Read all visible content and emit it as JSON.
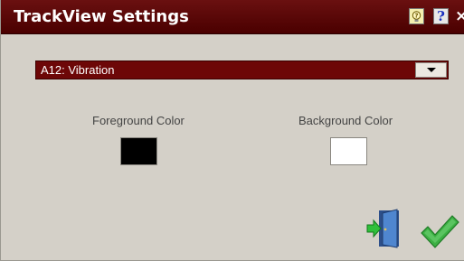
{
  "window": {
    "title": "TrackView Settings",
    "hint_icon": "hint-bulb-icon",
    "help_label": "?",
    "close_label": "×"
  },
  "track_select": {
    "selected": "A12: Vibration"
  },
  "foreground": {
    "label": "Foreground Color",
    "color": "#000000"
  },
  "background": {
    "label": "Background Color",
    "color": "#ffffff"
  },
  "actions": {
    "exit_icon": "exit-door-icon",
    "ok_icon": "checkmark-icon"
  },
  "colors": {
    "titlebar": "#5a0808",
    "dropdown": "#6d0707",
    "window_bg": "#d4d0c8",
    "ok_green": "#3cb043",
    "door_blue": "#3f6fb5"
  }
}
